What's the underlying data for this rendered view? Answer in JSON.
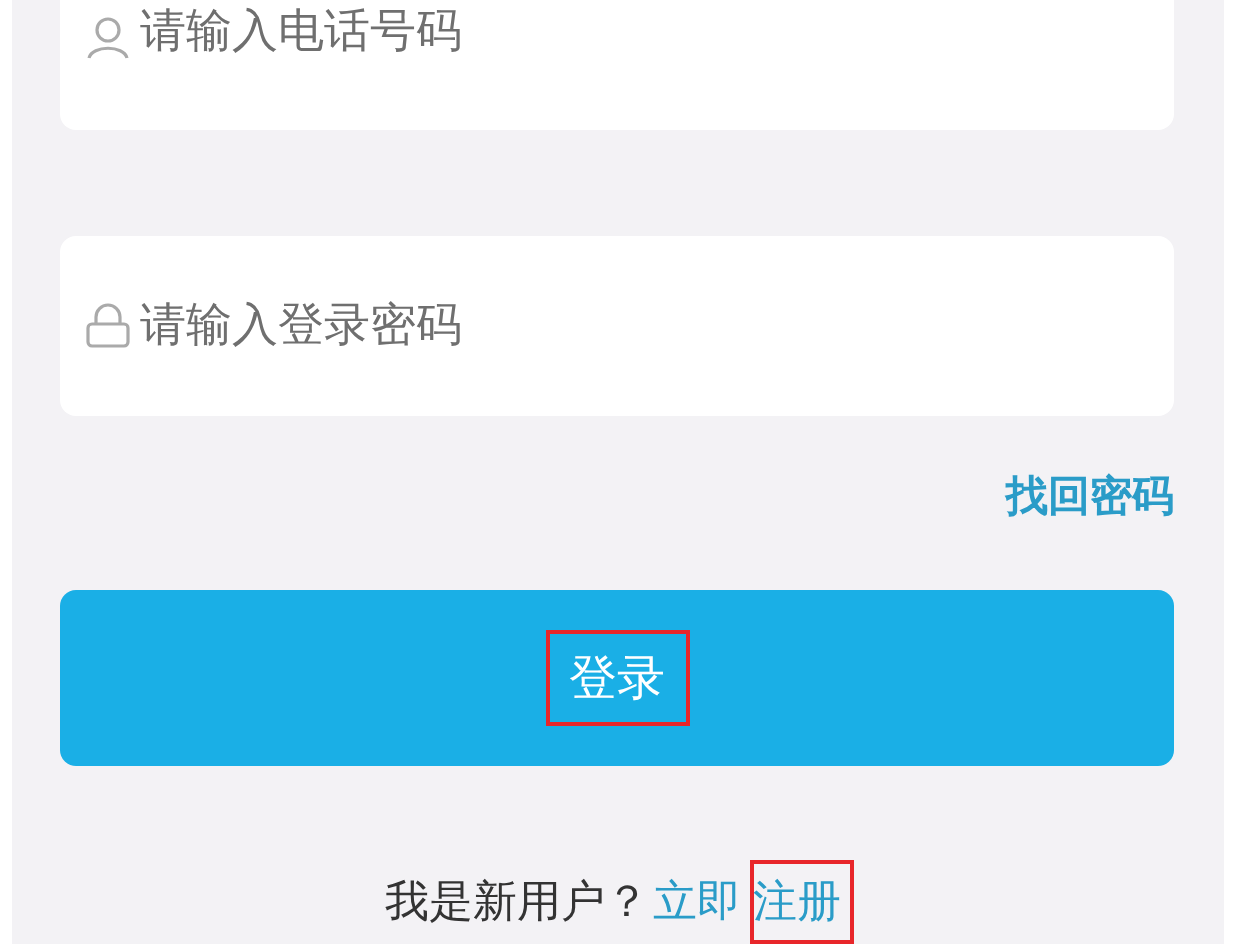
{
  "phone_field": {
    "placeholder": "请输入电话号码"
  },
  "password_field": {
    "placeholder": "请输入登录密码"
  },
  "forgot_password_link": "找回密码",
  "login_button": {
    "label": "登录",
    "highlighted": true
  },
  "register_prompt": {
    "text": "我是新用户？",
    "link_parts": [
      {
        "text": "立即",
        "highlighted": false
      },
      {
        "text": "注册",
        "highlighted": true
      }
    ]
  }
}
